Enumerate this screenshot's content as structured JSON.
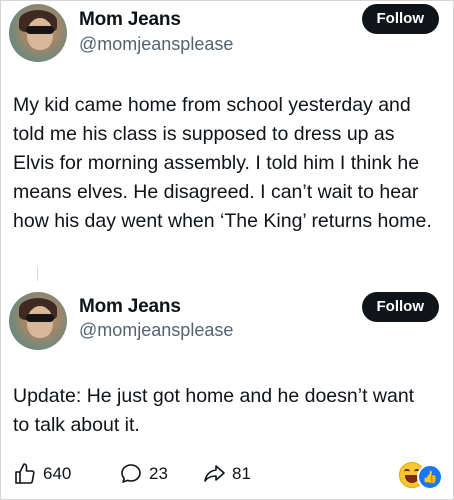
{
  "post1": {
    "author_name": "Mom Jeans",
    "author_handle": "@momjeansplease",
    "follow_label": "Follow",
    "text": "My kid came home from school yesterday and told me his class is supposed to dress up as Elvis for morning assembly. I told him I think he means elves. He disagreed. I can’t wait to hear how his day went when ‘The King’ returns home."
  },
  "post2": {
    "author_name": "Mom Jeans",
    "author_handle": "@momjeansplease",
    "follow_label": "Follow",
    "text": "Update: He just got home and he doesn’t want to talk about it."
  },
  "actions": {
    "likes": "640",
    "comments": "23",
    "shares": "81"
  },
  "icons": {
    "like": "thumbs-up-icon",
    "comment": "comment-bubble-icon",
    "share": "share-arrow-icon",
    "reaction_laugh": "laughing-emoji-icon",
    "reaction_like": "like-reaction-icon"
  },
  "colors": {
    "text": "#0f1419",
    "secondary": "#536471",
    "follow_button": "#0f1419",
    "like_reaction": "#1877f2",
    "laugh_reaction": "#f7c630"
  }
}
